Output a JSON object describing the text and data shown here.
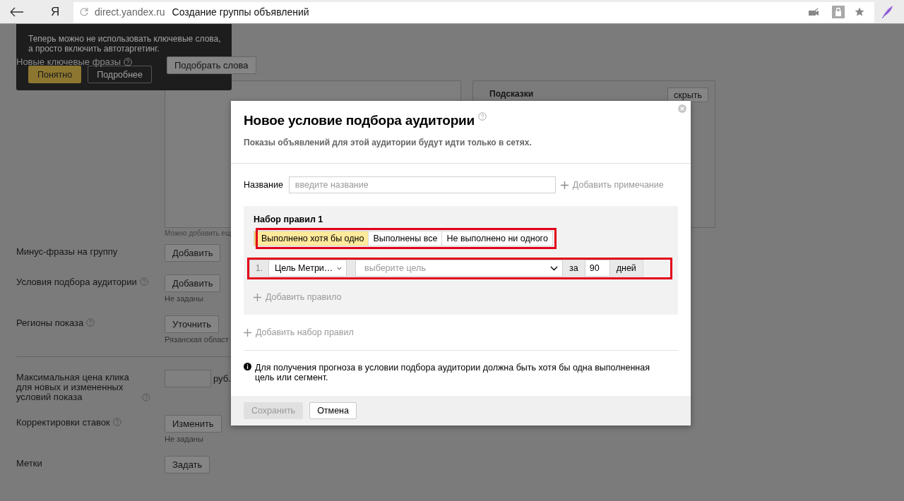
{
  "browser": {
    "logo": "Я",
    "domain": "direct.yandex.ru",
    "page_title": "Создание группы объявлений"
  },
  "tooltip": {
    "text": "Теперь можно не использовать ключевые слова,\nа просто включить автотаргетинг.",
    "buttons": [
      {
        "label": "Понятно",
        "kind": "primary"
      },
      {
        "label": "Подробнее",
        "kind": "secondary"
      }
    ]
  },
  "form": {
    "keywords": {
      "label": "Новые ключевые фразы",
      "help": true,
      "button": "Подобрать слова",
      "hint": "Можно добавить ещ"
    },
    "hints_panel": {
      "title": "Подсказки",
      "button": "скрыть"
    },
    "rows": [
      {
        "kind": "button",
        "label": "Минус-фразы на группу",
        "help": false,
        "button": "Добавить"
      },
      {
        "kind": "button",
        "label": "Условия подбора аудитории",
        "help": true,
        "button": "Добавить",
        "note": "Не заданы"
      },
      {
        "kind": "button",
        "label": "Регионы показа",
        "help": true,
        "button": "Уточнить",
        "note": "Рязанская област"
      },
      {
        "kind": "divider"
      },
      {
        "kind": "price",
        "label": "Максимальная цена клика для новых и измененных условий показа",
        "help": true,
        "unit": "руб."
      },
      {
        "kind": "button",
        "label": "Корректировки ставок",
        "help": true,
        "button": "Изменить",
        "note": "Не заданы"
      },
      {
        "kind": "button",
        "label": "Метки",
        "help": false,
        "button": "Задать"
      }
    ]
  },
  "modal": {
    "title": "Новое условие подбора аудитории",
    "help": true,
    "subtitle": "Показы объявлений для этой аудитории будут идти только в сетях.",
    "name_field": {
      "label": "Название",
      "placeholder": "введите название"
    },
    "add_note": "Добавить примечание",
    "rule_sets": [
      {
        "title": "Набор правил 1",
        "modes_highlighted": true,
        "modes": [
          {
            "label": "Выполнено хотя бы одно",
            "selected": true
          },
          {
            "label": "Выполнены все",
            "selected": false
          },
          {
            "label": "Не выполнено ни одного",
            "selected": false
          }
        ],
        "rules_highlighted": true,
        "rules": [
          {
            "number": "1.",
            "type": "Цель Метри…",
            "goal_placeholder": "выберите цель",
            "prefix": "за",
            "days": "90",
            "suffix": "дней"
          }
        ],
        "add_rule": "Добавить правило"
      }
    ],
    "add_rule_set": "Добавить набор правил",
    "note": "Для получения прогноза в условии подбора аудитории должна быть хотя бы одна выполненная цель или сегмент.",
    "buttons": [
      {
        "label": "Сохранить",
        "disabled": true
      },
      {
        "label": "Отмена",
        "disabled": false
      }
    ]
  }
}
